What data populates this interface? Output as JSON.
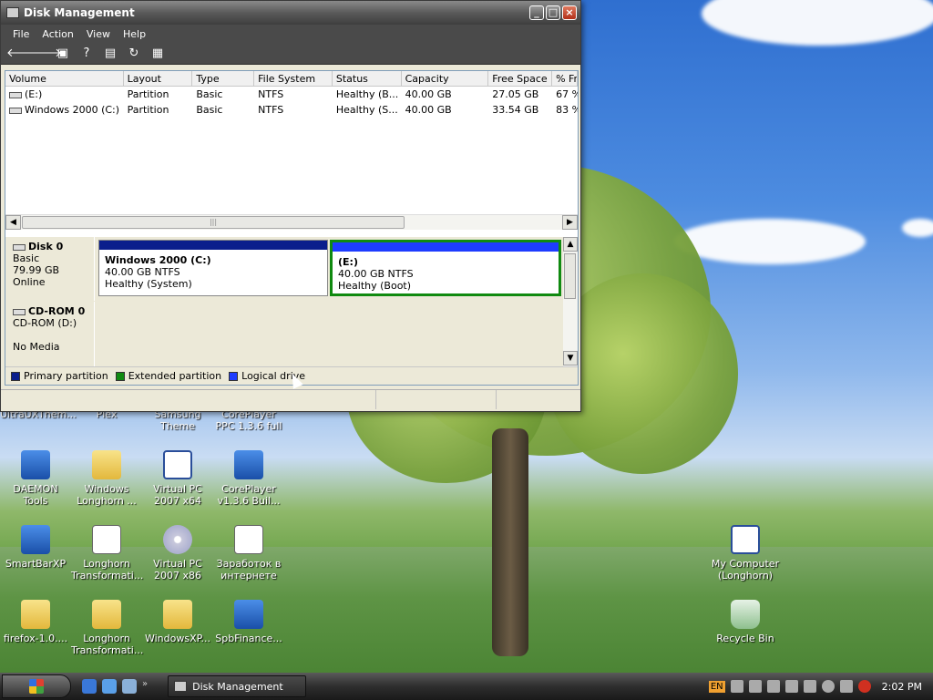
{
  "window": {
    "title": "Disk Management",
    "menu": [
      "File",
      "Action",
      "View",
      "Help"
    ],
    "toolbar_icons": [
      "back-arrow-icon",
      "forward-arrow-icon",
      "console-tree-icon",
      "help-icon",
      "properties-icon",
      "refresh-icon",
      "settings-icon"
    ]
  },
  "volume_list": {
    "columns": [
      "Volume",
      "Layout",
      "Type",
      "File System",
      "Status",
      "Capacity",
      "Free Space",
      "% Fr"
    ],
    "rows": [
      [
        "(E:)",
        "Partition",
        "Basic",
        "NTFS",
        "Healthy (B...",
        "40.00 GB",
        "27.05 GB",
        "67 %"
      ],
      [
        "Windows 2000 (C:)",
        "Partition",
        "Basic",
        "NTFS",
        "Healthy (S...",
        "40.00 GB",
        "33.54 GB",
        "83 %"
      ]
    ]
  },
  "disks": {
    "disk0": {
      "name": "Disk 0",
      "type": "Basic",
      "size": "79.99 GB",
      "state": "Online",
      "partitions": [
        {
          "name": "Windows 2000  (C:)",
          "size": "40.00 GB NTFS",
          "status": "Healthy (System)",
          "color": "#0a1e8c"
        },
        {
          "name": "(E:)",
          "size": "40.00 GB NTFS",
          "status": "Healthy (Boot)",
          "color": "#1e3cff"
        }
      ]
    },
    "cdrom0": {
      "name": "CD-ROM 0",
      "drive": "CD-ROM (D:)",
      "media": "No Media"
    }
  },
  "legend": [
    {
      "label": "Primary partition",
      "color": "#0a1e8c"
    },
    {
      "label": "Extended partition",
      "color": "#108a10"
    },
    {
      "label": "Logical drive",
      "color": "#1e3cff"
    }
  ],
  "desktop_icons": {
    "row0": [
      "UltraUXThem...",
      "Plex",
      "Samsung Theme",
      "CorePlayer PPC 1.3.6 full"
    ],
    "row1": [
      "DAEMON Tools",
      "Windows Longhorn ...",
      "Virtual PC 2007 x64",
      "CorePlayer v1.3.6 Buil..."
    ],
    "row2": [
      "SmartBarXP",
      "Longhorn Transformati...",
      "Virtual PC 2007 x86",
      "Заработок в интернете"
    ],
    "row3": [
      "firefox-1.0....",
      "Longhorn Transformati...",
      "WindowsXP...",
      "SpbFinance..."
    ],
    "right": [
      "My Computer (Longhorn)",
      "Recycle Bin"
    ]
  },
  "taskbar": {
    "task_label": "Disk Management",
    "lang": "EN",
    "clock": "2:02 PM"
  }
}
